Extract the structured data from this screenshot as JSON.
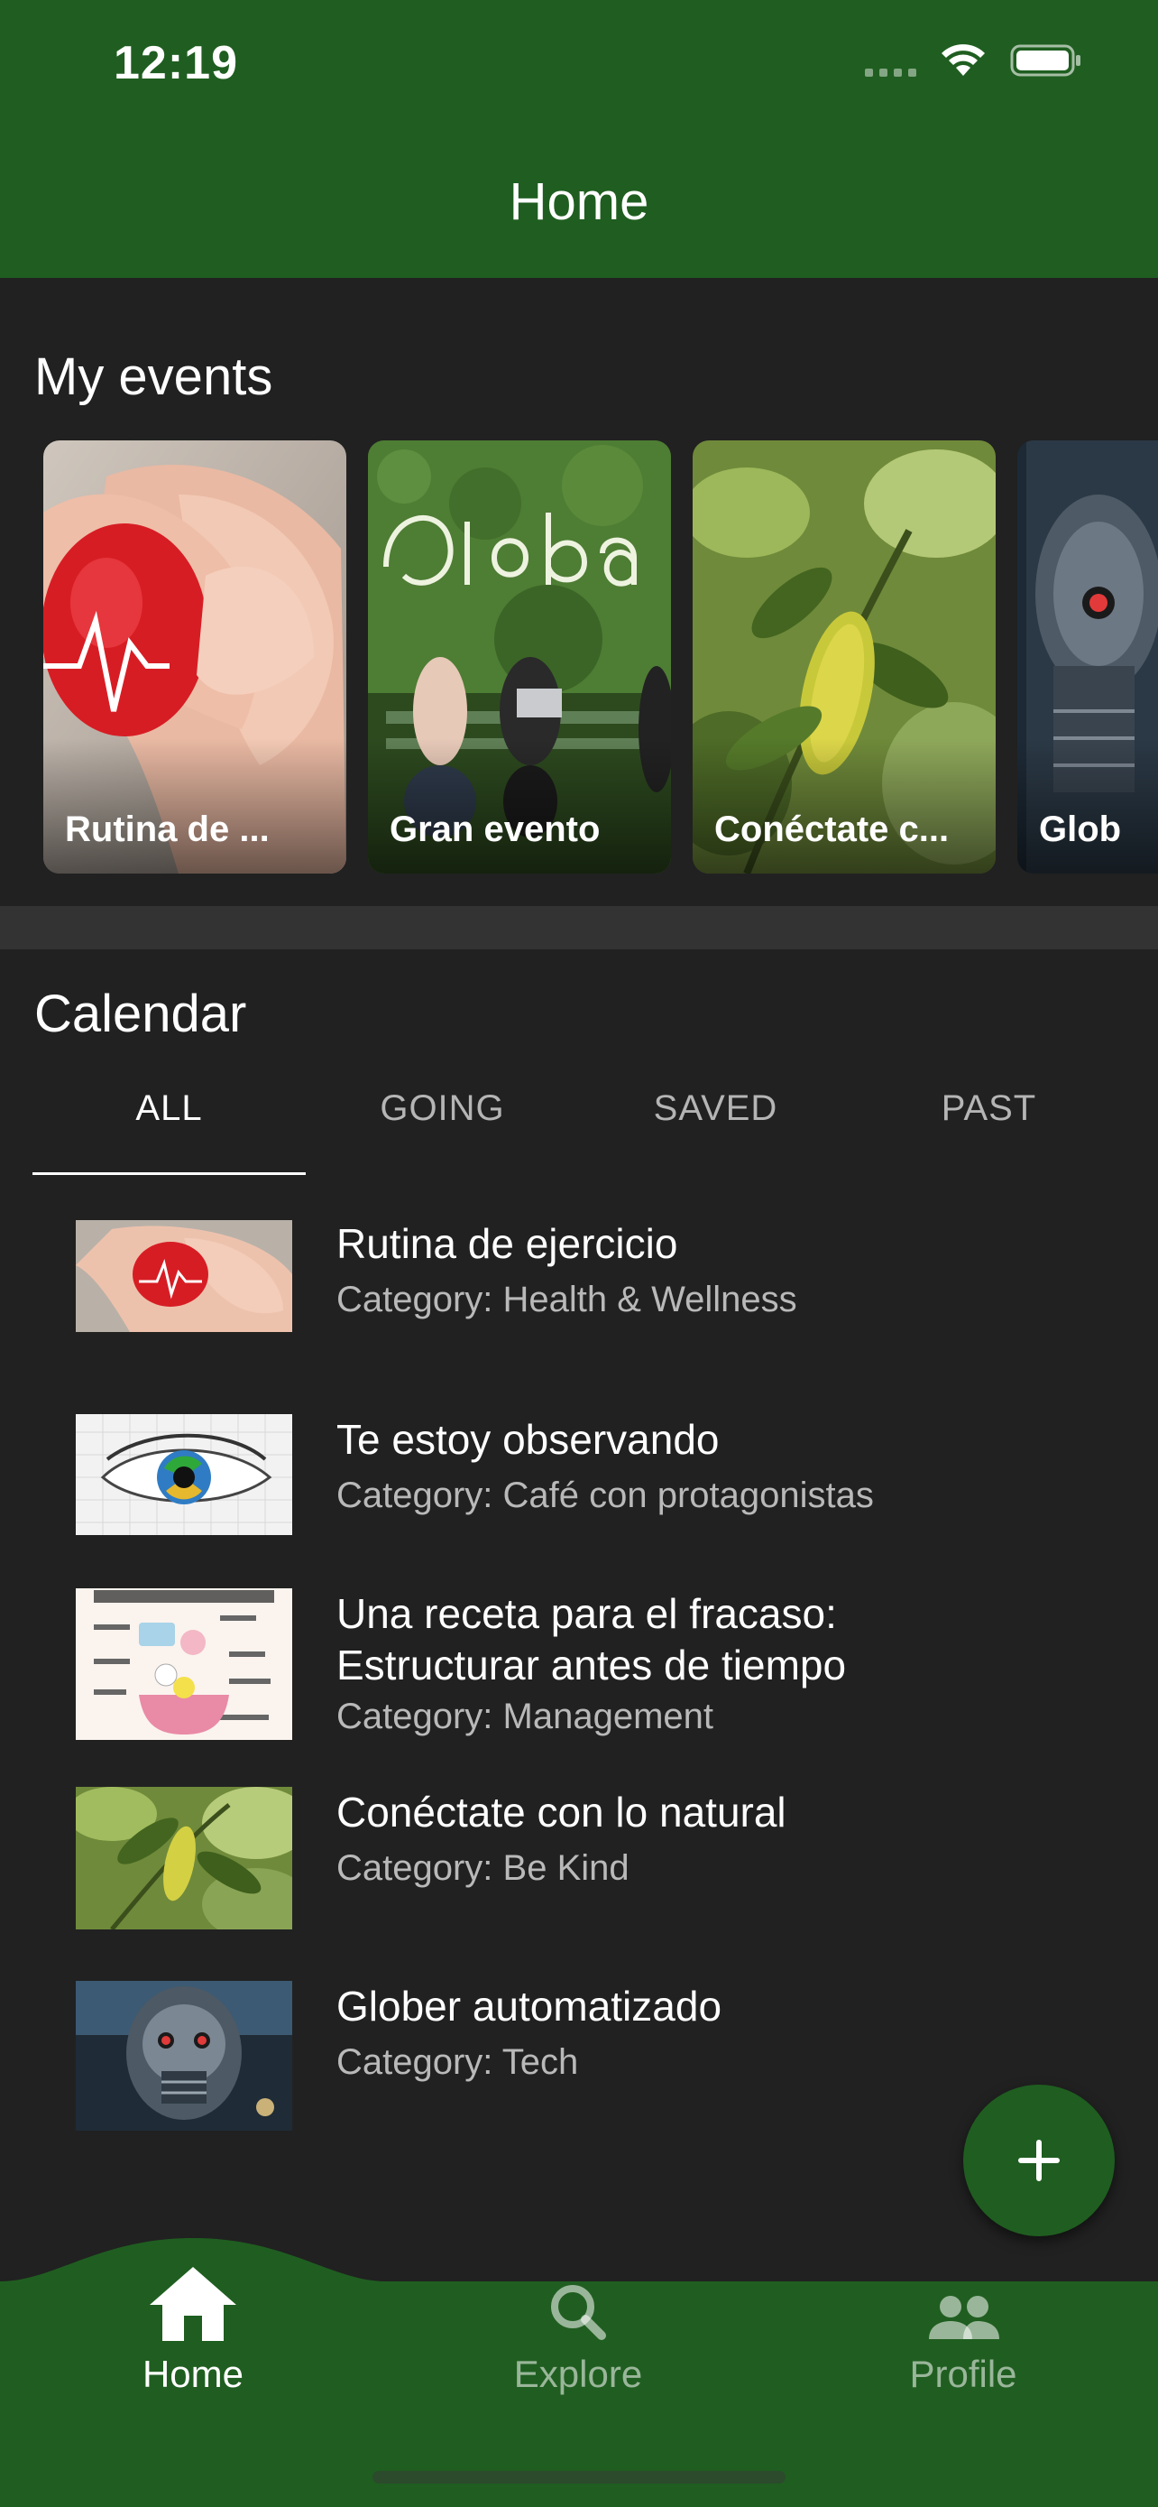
{
  "status_bar": {
    "time": "12:19"
  },
  "header": {
    "title": "Home"
  },
  "my_events": {
    "title": "My events",
    "cards": [
      {
        "label": "Rutina de ..."
      },
      {
        "label": "Gran evento"
      },
      {
        "label": "Conéctate c..."
      },
      {
        "label": "Glob"
      }
    ]
  },
  "calendar": {
    "title": "Calendar",
    "tabs": [
      {
        "label": "ALL",
        "active": true
      },
      {
        "label": "GOING",
        "active": false
      },
      {
        "label": "SAVED",
        "active": false
      },
      {
        "label": "PAST",
        "active": false
      }
    ],
    "items": [
      {
        "title": "Rutina de ejercicio",
        "category": "Category: Health & Wellness"
      },
      {
        "title": "Te estoy observando",
        "category": "Category: Café con protagonistas"
      },
      {
        "title_line1": "Una receta para el fracaso:",
        "title_line2": "Estructurar antes de tiempo",
        "category": "Category: Management"
      },
      {
        "title": "Conéctate con lo natural",
        "category": "Category: Be Kind"
      },
      {
        "title": "Glober automatizado",
        "category": "Category: Tech"
      }
    ]
  },
  "fab": {
    "icon": "plus-icon"
  },
  "bottom_nav": {
    "items": [
      {
        "label": "Home",
        "icon": "home-icon",
        "active": true
      },
      {
        "label": "Explore",
        "icon": "search-icon",
        "active": false
      },
      {
        "label": "Profile",
        "icon": "people-icon",
        "active": false
      }
    ]
  },
  "colors": {
    "primary": "#1f5e20",
    "background": "#212121",
    "band": "#333333"
  }
}
